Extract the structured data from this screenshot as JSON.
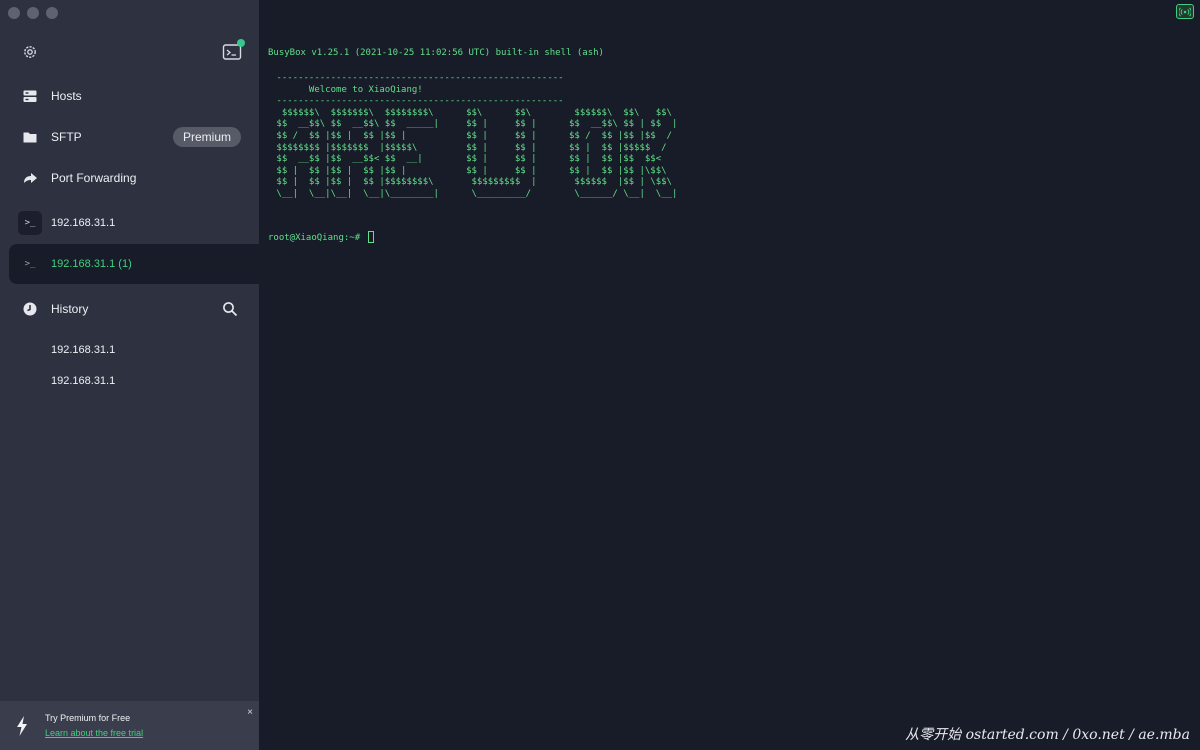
{
  "sidebar": {
    "nav": [
      {
        "label": "Hosts",
        "icon": "hosts-icon"
      },
      {
        "label": "SFTP",
        "icon": "folder-icon",
        "badge": "Premium"
      },
      {
        "label": "Port Forwarding",
        "icon": "forward-arrow-icon"
      }
    ],
    "sessions": [
      {
        "label": "192.168.31.1",
        "active": false
      },
      {
        "label": "192.168.31.1 (1)",
        "active": true
      }
    ],
    "history": {
      "label": "History",
      "items": [
        "192.168.31.1",
        "192.168.31.1"
      ]
    },
    "promo": {
      "title": "Try Premium for Free",
      "link": "Learn about the free trial",
      "close": "×"
    }
  },
  "terminal": {
    "banner": "BusyBox v1.25.1 (2021-10-25 11:02:56 UTC) built-in shell (ash)",
    "ascii": " -----------------------------------------------------\n       Welcome to XiaoQiang!\n -----------------------------------------------------\n  $$$$$$\\  $$$$$$$\\  $$$$$$$$\\      $$\\      $$\\        $$$$$$\\  $$\\   $$\\\n $$  __$$\\ $$  __$$\\ $$  _____|     $$ |     $$ |      $$  __$$\\ $$ | $$  |\n $$ /  $$ |$$ |  $$ |$$ |           $$ |     $$ |      $$ /  $$ |$$ |$$  /\n $$$$$$$$ |$$$$$$$  |$$$$$\\         $$ |     $$ |      $$ |  $$ |$$$$$  /\n $$  __$$ |$$  __$$< $$  __|        $$ |     $$ |      $$ |  $$ |$$  $$<\n $$ |  $$ |$$ |  $$ |$$ |           $$ |     $$ |      $$ |  $$ |$$ |\\$$\\\n $$ |  $$ |$$ |  $$ |$$$$$$$$\\       $$$$$$$$$  |       $$$$$$  |$$ | \\$$\\\n \\__|  \\__|\\__|  \\__|\\________|      \\_________/        \\______/ \\__|  \\__|",
    "prompt": "root@XiaoQiang:~# "
  },
  "watermark": "从零开始 ostarted.com / 0xo.net / ae.mba",
  "colors": {
    "accent": "#3fd07f",
    "terminal_text": "#5fe089",
    "sidebar_bg": "#2d3140",
    "terminal_bg": "#181b28"
  }
}
